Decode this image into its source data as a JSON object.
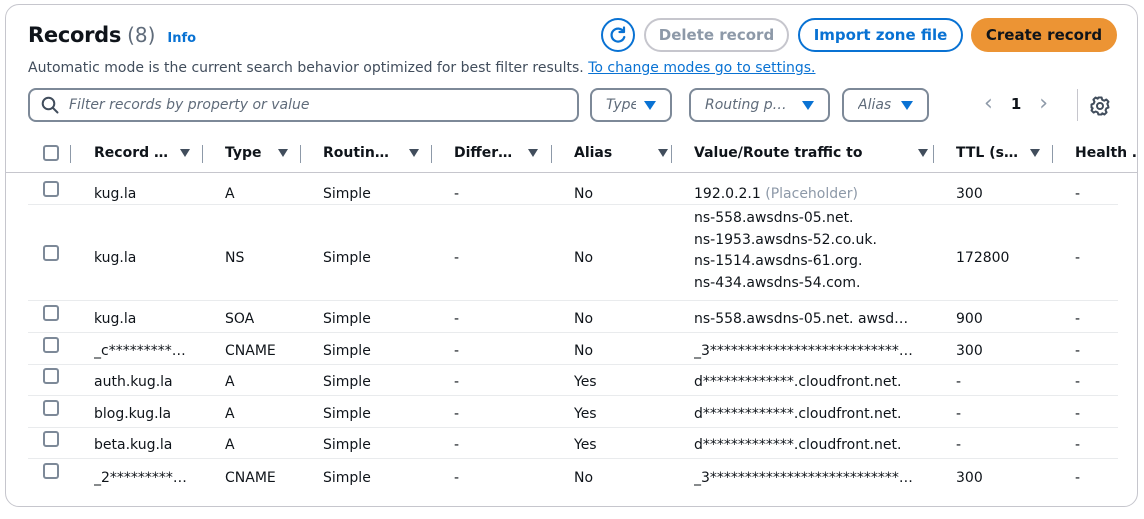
{
  "header": {
    "title": "Records",
    "count": "(8)",
    "info": "Info",
    "subtitle": "Automatic mode is the current search behavior optimized for best filter results.",
    "subtitle_link": "To change modes go to settings."
  },
  "actions": {
    "refresh_icon": "refresh-icon",
    "delete": "Delete record",
    "import": "Import zone file",
    "create": "Create record"
  },
  "filters": {
    "search_placeholder": "Filter records by property or value",
    "type": "Type",
    "routing": "Routing p…",
    "alias": "Alias"
  },
  "pagination": {
    "page": "1",
    "prev": "‹",
    "next": "›"
  },
  "columns": [
    "Record …",
    "Type",
    "Routin…",
    "Differ…",
    "Alias",
    "Value/Route traffic to",
    "TTL (s…",
    "Health …"
  ],
  "rows": [
    {
      "name": "kug.la",
      "type": "A",
      "routing": "Simple",
      "diff": "-",
      "alias": "No",
      "value": "192.0.2.1",
      "value_note": "(Placeholder)",
      "ttl": "300",
      "health": "-"
    },
    {
      "name": "kug.la",
      "type": "NS",
      "routing": "Simple",
      "diff": "-",
      "alias": "No",
      "values": [
        "ns-558.awsdns-05.net.",
        "ns-1953.awsdns-52.co.uk.",
        "ns-1514.awsdns-61.org.",
        "ns-434.awsdns-54.com."
      ],
      "ttl": "172800",
      "health": "-"
    },
    {
      "name": "kug.la",
      "type": "SOA",
      "routing": "Simple",
      "diff": "-",
      "alias": "No",
      "value": "ns-558.awsdns-05.net. awsd…",
      "ttl": "900",
      "health": "-"
    },
    {
      "name": "_c*********…",
      "type": "CNAME",
      "routing": "Simple",
      "diff": "-",
      "alias": "No",
      "value": "_3*******************************…",
      "ttl": "300",
      "health": "-"
    },
    {
      "name": "auth.kug.la",
      "type": "A",
      "routing": "Simple",
      "diff": "-",
      "alias": "Yes",
      "value": "d*************.cloudfront.net.",
      "ttl": "-",
      "health": "-"
    },
    {
      "name": "blog.kug.la",
      "type": "A",
      "routing": "Simple",
      "diff": "-",
      "alias": "Yes",
      "value": "d*************.cloudfront.net.",
      "ttl": "-",
      "health": "-"
    },
    {
      "name": "beta.kug.la",
      "type": "A",
      "routing": "Simple",
      "diff": "-",
      "alias": "Yes",
      "value": "d*************.cloudfront.net.",
      "ttl": "-",
      "health": "-"
    },
    {
      "name": "_2*********…",
      "type": "CNAME",
      "routing": "Simple",
      "diff": "-",
      "alias": "No",
      "value": "_3*******************************…",
      "ttl": "300",
      "health": "-"
    }
  ]
}
